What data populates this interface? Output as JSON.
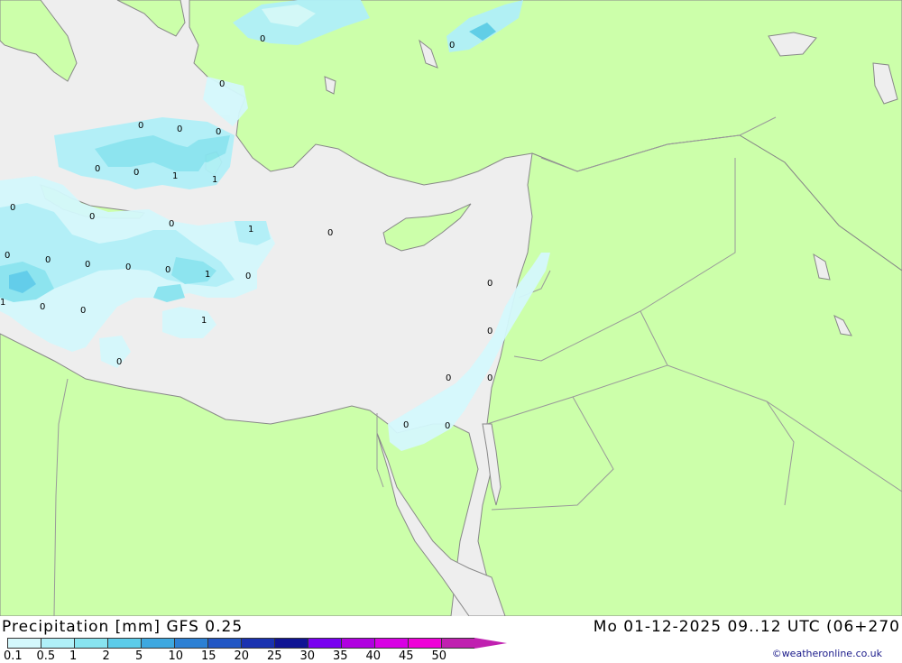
{
  "title": {
    "product": "Precipitation [mm] GFS 0.25",
    "valid_time": "Mo 01-12-2025 09..12 UTC (06+270"
  },
  "credit": "©weatheronline.co.uk",
  "colors": {
    "land": "#ccffaa",
    "sea": "#eeeeee",
    "border": "#999999",
    "coast": "#888888"
  },
  "legend": {
    "swatches": [
      "#d4f8fc",
      "#b0f0f8",
      "#88e4f0",
      "#5cccea",
      "#3ea8e0",
      "#2c80d4",
      "#2156c4",
      "#1a32b0",
      "#101494",
      "#7800f0",
      "#b000e0",
      "#d800e4",
      "#ef00d8",
      "#c020b0"
    ],
    "arrow_color": "#c020b0",
    "labels": [
      "0.1",
      "0.5",
      "1",
      "2",
      "5",
      "10",
      "15",
      "20",
      "25",
      "30",
      "35",
      "40",
      "45",
      "50"
    ]
  },
  "contour_labels": [
    "0",
    "0",
    "0",
    "0",
    "0",
    "0",
    "1",
    "1",
    "0",
    "0",
    "0",
    "1",
    "0",
    "0",
    "0",
    "0",
    "1",
    "0",
    "1",
    "0",
    "0",
    "1",
    "0",
    "0",
    "0",
    "0",
    "0",
    "0",
    "0",
    "0",
    "0"
  ]
}
